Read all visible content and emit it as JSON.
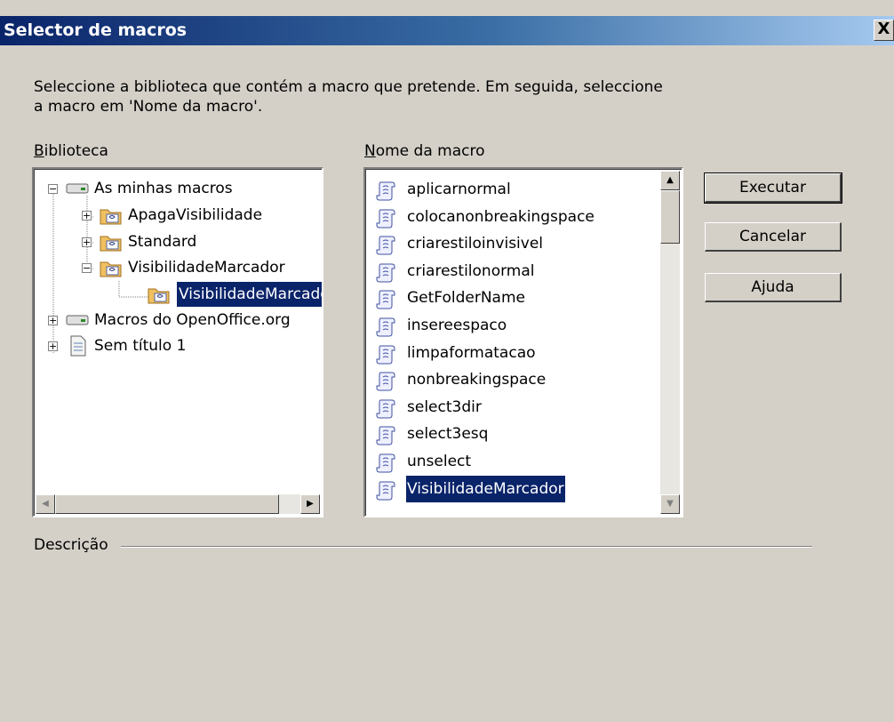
{
  "window": {
    "title": "Selector de macros",
    "close_label": "X"
  },
  "instructions": "Seleccione a biblioteca que contém a macro que pretende. Em seguida, seleccione a macro em 'Nome da macro'.",
  "library": {
    "label_first": "B",
    "label_rest": "iblioteca",
    "nodes": [
      {
        "label": "As minhas macros",
        "icon": "drive-icon",
        "expander": "−"
      },
      {
        "label": "ApagaVisibilidade",
        "icon": "folder-icon",
        "expander": "+"
      },
      {
        "label": "Standard",
        "icon": "folder-icon",
        "expander": "+"
      },
      {
        "label": "VisibilidadeMarcador",
        "icon": "folder-icon",
        "expander": "−"
      },
      {
        "label": "VisibilidadeMarcador",
        "icon": "folder-icon",
        "selected": true
      },
      {
        "label": "Macros do OpenOffice.org",
        "icon": "drive-icon",
        "expander": "+"
      },
      {
        "label": "Sem título 1",
        "icon": "document-icon",
        "expander": "+"
      }
    ]
  },
  "macro_list": {
    "label_first": "N",
    "label_rest": "ome da macro",
    "items": [
      "aplicarnormal",
      "colocanonbreakingspace",
      "criarestiloinvisivel",
      "criarestilonormal",
      "GetFolderName",
      "insereespaco",
      "limpaformatacao",
      "nonbreakingspace",
      "select3dir",
      "select3esq",
      "unselect",
      "VisibilidadeMarcador"
    ],
    "selected": "VisibilidadeMarcador"
  },
  "buttons": {
    "run": "Executar",
    "cancel": "Cancelar",
    "help": "Ajuda"
  },
  "description_label": "Descrição",
  "colors": {
    "title_bar_start": "#0a246a",
    "title_bar_end": "#a6caf0",
    "selection": "#0a246a",
    "dialog_bg": "#d4d0c8"
  }
}
